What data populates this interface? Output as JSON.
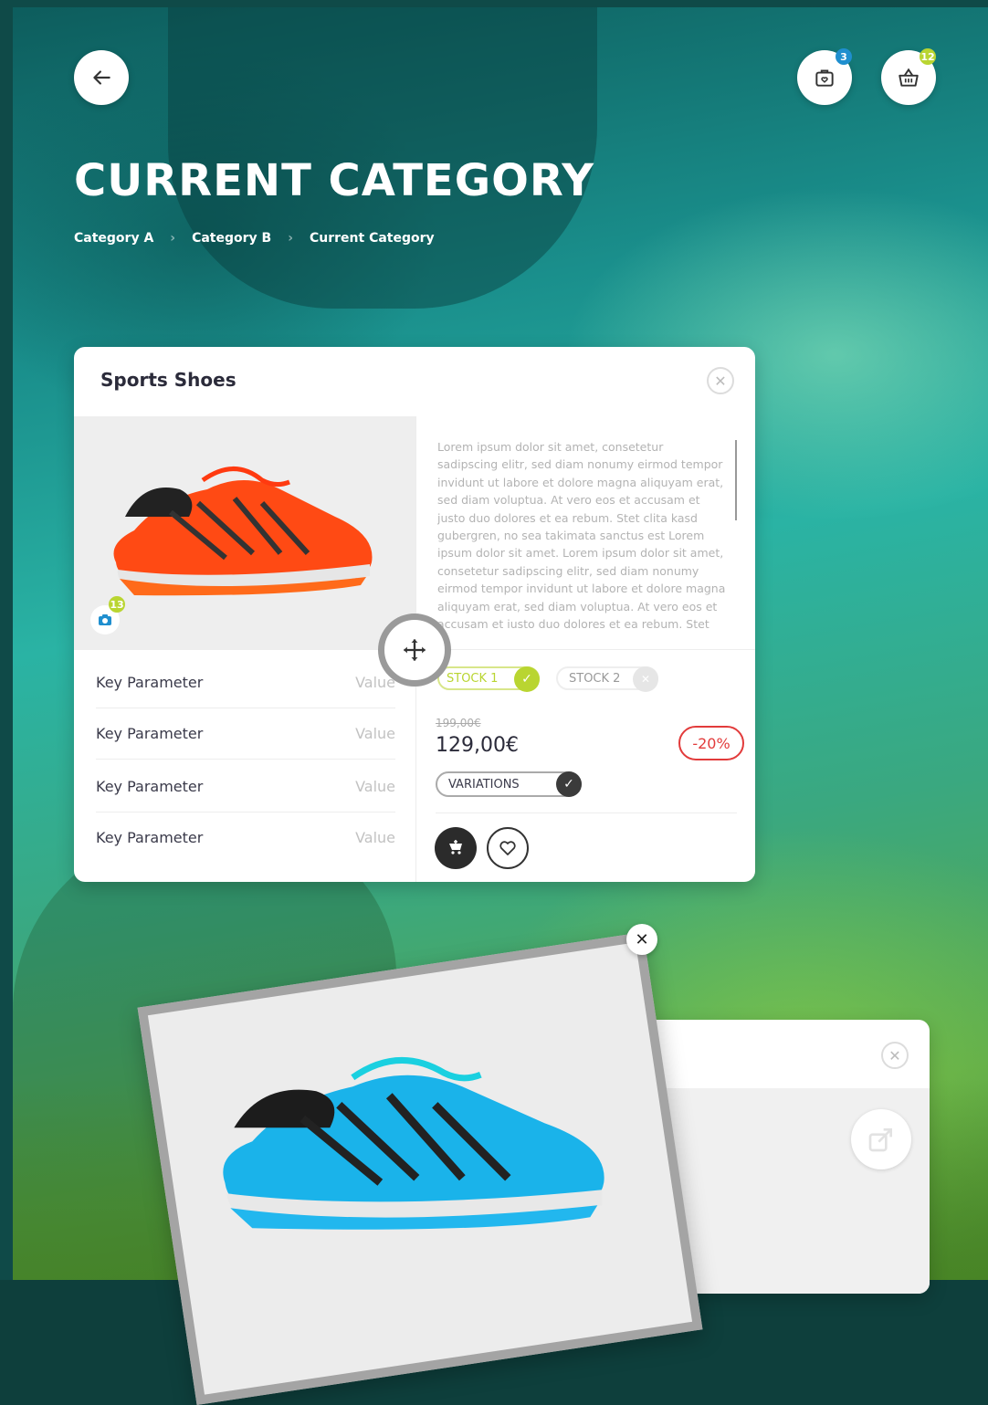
{
  "header": {
    "back_label": "back",
    "wishlist_badge": "3",
    "cart_badge": "12",
    "title": "CURRENT CATEGORY"
  },
  "breadcrumb": [
    {
      "label": "Category A"
    },
    {
      "label": "Category B"
    },
    {
      "label": "Current Category"
    }
  ],
  "product": {
    "title": "Sports Shoes",
    "photo_count": "13",
    "description": "Lorem ipsum dolor sit amet, consetetur sadipscing elitr, sed diam nonumy eirmod tempor invidunt ut labore et dolore magna aliquyam erat, sed diam voluptua. At vero eos et accusam et justo duo dolores et ea rebum. Stet clita kasd gubergren, no sea takimata sanctus est Lorem ipsum dolor sit amet. Lorem ipsum dolor sit amet, consetetur sadipscing elitr, sed diam nonumy eirmod tempor invidunt ut labore et dolore magna aliquyam erat, sed diam voluptua. At vero eos et accusam et justo duo dolores et ea rebum. Stet clita kasd gubergren",
    "params": [
      {
        "key": "Key Parameter",
        "value": "Value"
      },
      {
        "key": "Key Parameter",
        "value": "Value"
      },
      {
        "key": "Key Parameter",
        "value": "Value"
      },
      {
        "key": "Key Parameter",
        "value": "Value"
      }
    ],
    "stock": [
      {
        "label": "STOCK 1",
        "available": true
      },
      {
        "label": "STOCK 2",
        "available": false
      }
    ],
    "price_old": "199,00€",
    "price_new": "129,00€",
    "discount": "-20%",
    "variations_label": "VARIATIONS"
  },
  "colors": {
    "accent_green": "#b9d531",
    "badge_blue": "#1f8fcf",
    "discount_red": "#e23b3b",
    "dark": "#2b2b2b"
  },
  "icons": {
    "back": "arrow-left-icon",
    "wishlist": "wishlist-bag-icon",
    "cart": "basket-icon",
    "close": "close-icon",
    "camera": "camera-icon",
    "move": "move-icon",
    "check": "check-icon",
    "add_to_cart": "cart-add-icon",
    "favorite": "heart-icon",
    "share": "share-icon"
  }
}
